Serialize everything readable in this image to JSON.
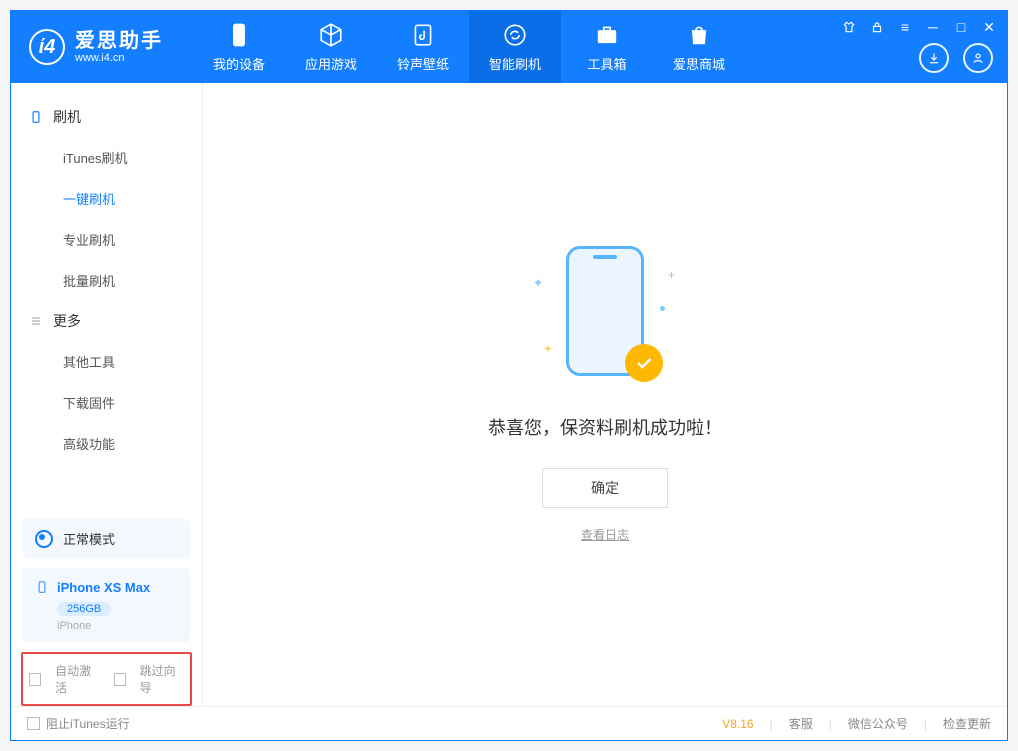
{
  "app": {
    "name_cn": "爱思助手",
    "name_en": "www.i4.cn"
  },
  "nav": {
    "tabs": [
      {
        "label": "我的设备"
      },
      {
        "label": "应用游戏"
      },
      {
        "label": "铃声壁纸"
      },
      {
        "label": "智能刷机"
      },
      {
        "label": "工具箱"
      },
      {
        "label": "爱思商城"
      }
    ],
    "active_index": 3
  },
  "sidebar": {
    "section1": "刷机",
    "items1": [
      {
        "label": "iTunes刷机"
      },
      {
        "label": "一键刷机"
      },
      {
        "label": "专业刷机"
      },
      {
        "label": "批量刷机"
      }
    ],
    "active1_index": 1,
    "section2": "更多",
    "items2": [
      {
        "label": "其他工具"
      },
      {
        "label": "下载固件"
      },
      {
        "label": "高级功能"
      }
    ],
    "mode_label": "正常模式",
    "device": {
      "name": "iPhone XS Max",
      "storage": "256GB",
      "type": "iPhone"
    },
    "checkboxes": {
      "auto_activate": "自动激活",
      "skip_guide": "跳过向导"
    }
  },
  "content": {
    "success": "恭喜您，保资料刷机成功啦！",
    "ok": "确定",
    "view_log": "查看日志"
  },
  "status": {
    "block_itunes": "阻止iTunes运行",
    "version": "V8.16",
    "links": {
      "service": "客服",
      "wechat": "微信公众号",
      "update": "检查更新"
    }
  }
}
